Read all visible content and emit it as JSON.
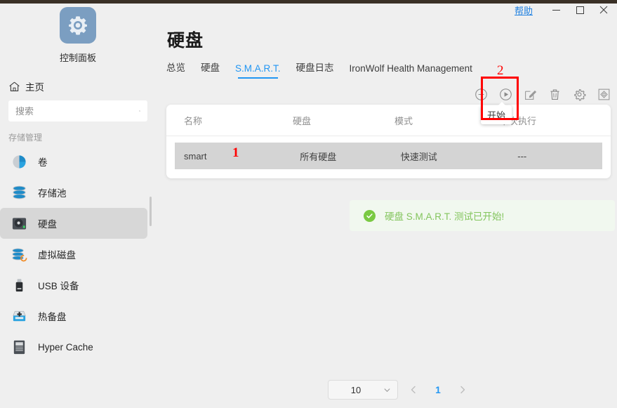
{
  "window": {
    "help_label": "帮助",
    "minimize_icon": "minimize-icon",
    "maximize_icon": "maximize-icon",
    "close_icon": "close-icon"
  },
  "sidebar": {
    "app_name": "控制面板",
    "app_icon": "gear-icon",
    "home_label": "主页",
    "home_icon": "home-icon",
    "search": {
      "placeholder": "搜索",
      "value": "",
      "icon": "search-icon"
    },
    "section_title": "存储管理",
    "items": [
      {
        "label": "卷",
        "icon": "volume-pie-icon",
        "active": false
      },
      {
        "label": "存储池",
        "icon": "storage-pool-icon",
        "active": false
      },
      {
        "label": "硬盘",
        "icon": "hard-disk-icon",
        "active": true
      },
      {
        "label": "虚拟磁盘",
        "icon": "virtual-disk-icon",
        "active": false
      },
      {
        "label": "USB 设备",
        "icon": "usb-device-icon",
        "active": false
      },
      {
        "label": "热备盘",
        "icon": "hot-spare-icon",
        "active": false
      },
      {
        "label": "Hyper Cache",
        "icon": "hyper-cache-icon",
        "active": false
      }
    ]
  },
  "main": {
    "page_title": "硬盘",
    "tabs": [
      {
        "label": "总览",
        "active": false
      },
      {
        "label": "硬盘",
        "active": false
      },
      {
        "label": "S.M.A.R.T.",
        "active": true
      },
      {
        "label": "硬盘日志",
        "active": false
      },
      {
        "label": "IronWolf Health Management",
        "active": false
      }
    ],
    "toolbar": [
      {
        "name": "add-button",
        "icon": "plus-circle-icon"
      },
      {
        "name": "start-button",
        "icon": "play-circle-icon"
      },
      {
        "name": "edit-button",
        "icon": "pencil-edit-icon"
      },
      {
        "name": "delete-button",
        "icon": "trash-icon"
      },
      {
        "name": "settings-button",
        "icon": "gear-icon"
      },
      {
        "name": "diagnose-button",
        "icon": "diamond-square-icon"
      }
    ],
    "tooltip": {
      "text": "开始"
    },
    "table": {
      "headers": [
        "名称",
        "硬盘",
        "模式",
        "下次执行"
      ],
      "rows": [
        {
          "name": "smart",
          "disk": "所有硬盘",
          "mode": "快速测试",
          "next_run": "---"
        }
      ]
    },
    "alert": {
      "icon": "success-check-icon",
      "message": "硬盘 S.M.A.R.T. 测试已开始!"
    },
    "pagination": {
      "page_size": "10",
      "prev_icon": "chevron-left-icon",
      "next_icon": "chevron-right-icon",
      "current_page": "1",
      "dropdown_icon": "chevron-down-icon"
    }
  },
  "annotations": [
    {
      "id": "1",
      "text": "1"
    },
    {
      "id": "2",
      "text": "2"
    }
  ],
  "colors": {
    "accent": "#2196f3",
    "annotation_red": "#ff0000",
    "success_green": "#7ac943",
    "logo_blue": "#7b9ec1",
    "background": "#efefef"
  }
}
